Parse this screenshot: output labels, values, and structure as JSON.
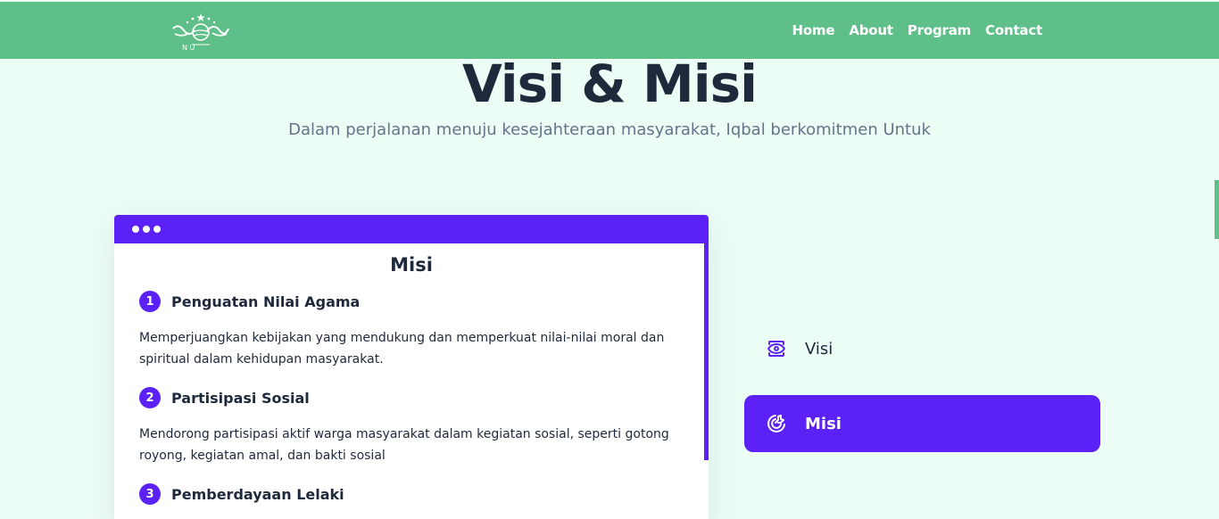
{
  "nav": {
    "logo_letters": "N U",
    "links": [
      "Home",
      "About",
      "Program",
      "Contact"
    ]
  },
  "hero": {
    "title": "Visi & Misi",
    "subtitle": "Dalam perjalanan menuju kesejahteraan masyarakat, Iqbal berkomitmen Untuk"
  },
  "card": {
    "title": "Misi",
    "items": [
      {
        "number": "1",
        "title": "Penguatan Nilai Agama",
        "description": "Memperjuangkan kebijakan yang mendukung dan memperkuat nilai-nilai moral dan spiritual dalam kehidupan masyarakat."
      },
      {
        "number": "2",
        "title": "Partisipasi Sosial",
        "description": "Mendorong partisipasi aktif warga masyarakat dalam kegiatan sosial, seperti gotong royong, kegiatan amal, dan bakti sosial"
      },
      {
        "number": "3",
        "title": "Pemberdayaan Lelaki",
        "description": ""
      }
    ]
  },
  "tabs": [
    {
      "label": "Visi",
      "icon": "eye-icon",
      "active": false
    },
    {
      "label": "Misi",
      "icon": "target-icon",
      "active": true
    }
  ],
  "colors": {
    "navbar": "#5ebf88",
    "accent": "#5b21f6",
    "background": "#ecfdf5",
    "heading": "#1e293b",
    "muted": "#64748b"
  }
}
